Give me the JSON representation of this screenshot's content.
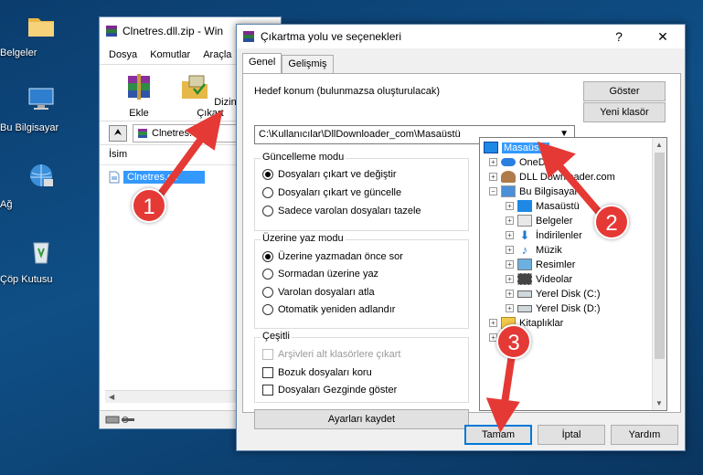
{
  "desktop": {
    "icons": [
      "Belgeler",
      "Bu Bilgisayar",
      "Ağ",
      "Çöp Kutusu"
    ]
  },
  "winrar": {
    "title": "Clnetres.dll.zip - Win",
    "menu": [
      "Dosya",
      "Komutlar",
      "Araçla"
    ],
    "tools": [
      "Ekle",
      "Dizine Çıkart"
    ],
    "path": "Clnetres.dll",
    "column": "İsim",
    "file": "Clnetres.dll"
  },
  "dialog": {
    "title": "Çıkartma yolu ve seçenekleri",
    "help": "?",
    "close": "✕",
    "tabs": [
      "Genel",
      "Gelişmiş"
    ],
    "target_label": "Hedef konum (bulunmazsa oluşturulacak)",
    "target_value": "C:\\Kullanıcılar\\DllDownloader_com\\Masaüstü",
    "show_button": "Göster",
    "new_folder_button": "Yeni klasör",
    "update_mode": {
      "title": "Güncelleme modu",
      "options": [
        "Dosyaları çıkart ve değiştir",
        "Dosyaları çıkart ve güncelle",
        "Sadece varolan dosyaları tazele"
      ],
      "selected": 0
    },
    "overwrite_mode": {
      "title": "Üzerine yaz modu",
      "options": [
        "Üzerine yazmadan önce sor",
        "Sormadan üzerine yaz",
        "Varolan dosyaları atla",
        "Otomatik yeniden adlandır"
      ],
      "selected": 0
    },
    "misc": {
      "title": "Çeşitli",
      "options": [
        "Arşivleri alt klasörlere çıkart",
        "Bozuk dosyaları koru",
        "Dosyaları Gezginde göster"
      ]
    },
    "save_settings": "Ayarları kaydet",
    "tree": [
      "Masaüstü",
      "OneDri",
      "DLL Downloader.com",
      "Bu Bilgisayar",
      "Masaüstü",
      "Belgeler",
      "İndirilenler",
      "Müzik",
      "Resimler",
      "Videolar",
      "Yerel Disk (C:)",
      "Yerel Disk (D:)",
      "Kitaplıklar",
      "Ağ"
    ],
    "ok": "Tamam",
    "cancel": "İptal",
    "help_button": "Yardım"
  },
  "annotations": {
    "step1": "1",
    "step2": "2",
    "step3": "3",
    "color": "#e53935"
  }
}
